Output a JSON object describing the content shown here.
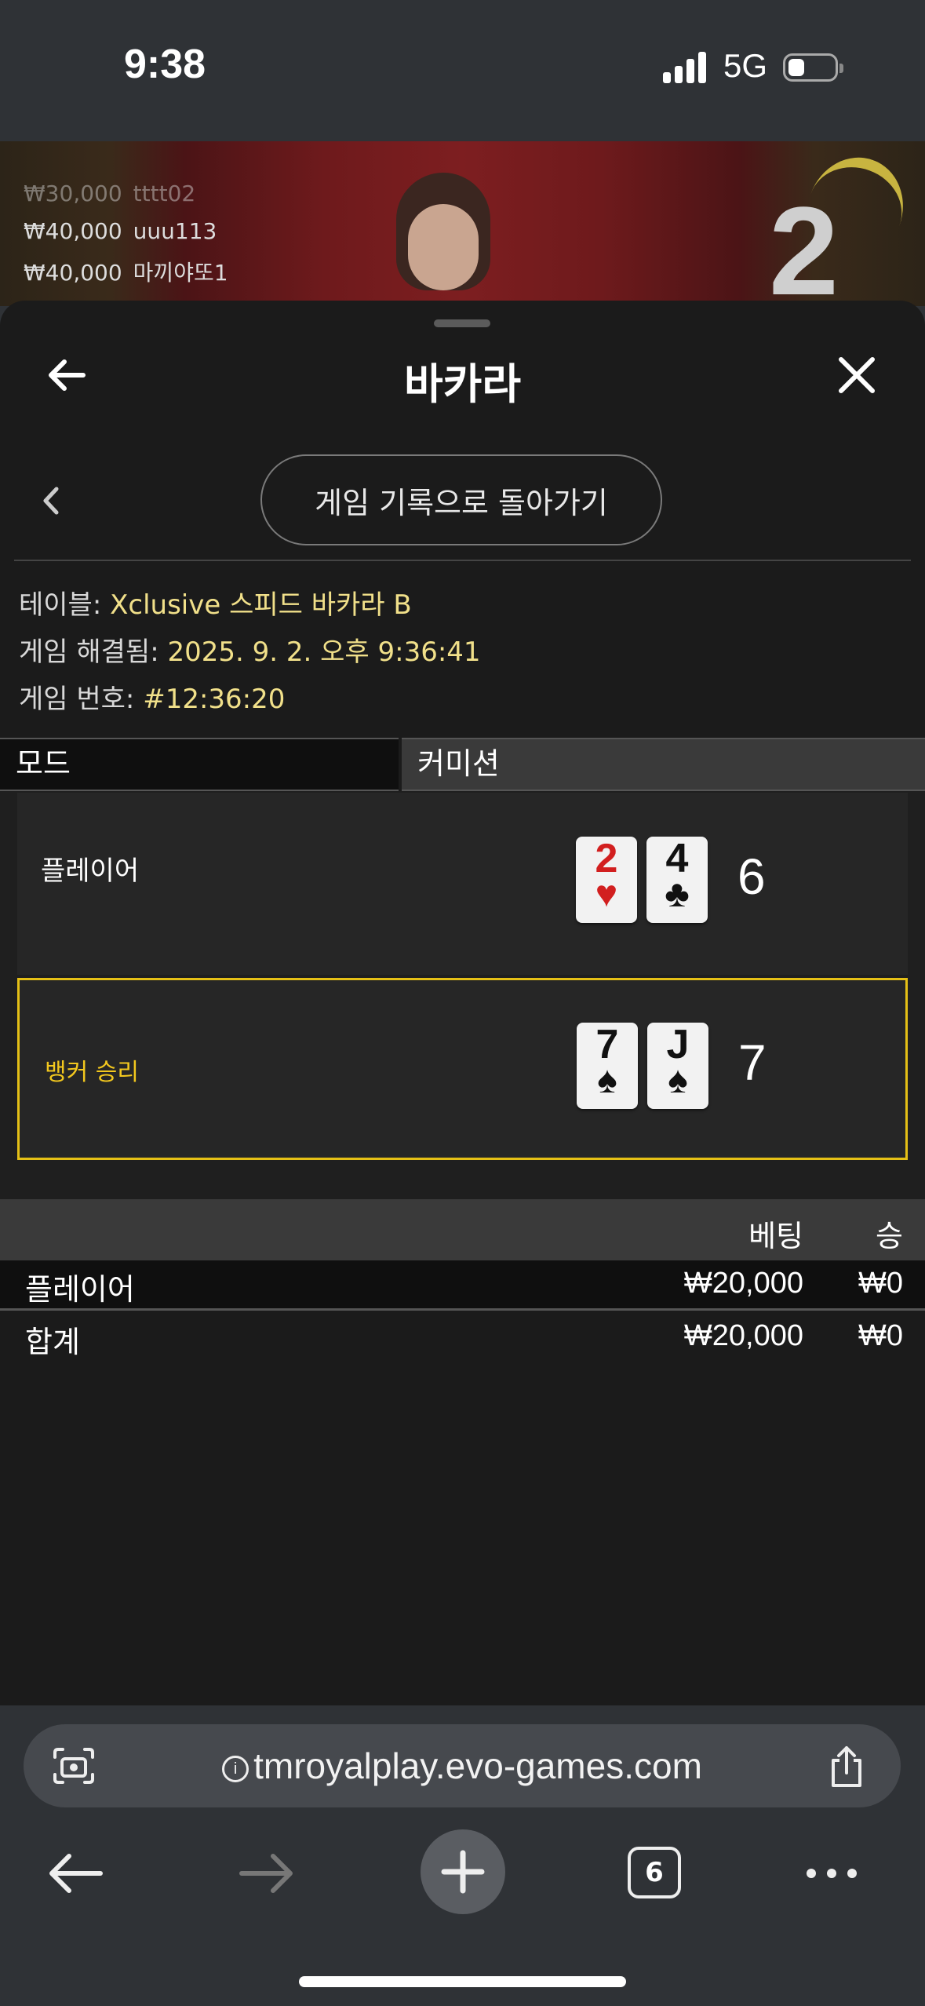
{
  "status_bar": {
    "time": "9:38",
    "network": "5G"
  },
  "video": {
    "ticker": [
      {
        "amount": "₩30,000",
        "user": "tttt02"
      },
      {
        "amount": "₩40,000",
        "user": "uuu113"
      },
      {
        "amount": "₩40,000",
        "user": "마끼야또1"
      }
    ],
    "countdown": "2"
  },
  "header": {
    "title": "바카라"
  },
  "back_to_history": "게임 기록으로 돌아가기",
  "info": {
    "table_label": "테이블:",
    "table_value": "Xclusive 스피드 바카라 B",
    "resolved_label": "게임 해결됨:",
    "resolved_value": "2025. 9. 2. 오후 9:36:41",
    "number_label": "게임 번호:",
    "number_value": "#12:36:20"
  },
  "mode": {
    "label": "모드",
    "value": "커미션"
  },
  "hands": [
    {
      "label": "플레이어",
      "winner": false,
      "score": "6",
      "cards": [
        {
          "rank": "2",
          "suit": "♥",
          "color": "red"
        },
        {
          "rank": "4",
          "suit": "♣",
          "color": "black"
        }
      ]
    },
    {
      "label": "뱅커 승리",
      "winner": true,
      "score": "7",
      "cards": [
        {
          "rank": "7",
          "suit": "♠",
          "color": "black"
        },
        {
          "rank": "J",
          "suit": "♠",
          "color": "black"
        }
      ]
    }
  ],
  "bets": {
    "header_bet": "베팅",
    "header_win": "승",
    "rows": [
      {
        "name": "플레이어",
        "bet": "₩20,000",
        "win": "₩0"
      }
    ],
    "total": {
      "name": "합계",
      "bet": "₩20,000",
      "win": "₩0"
    }
  },
  "browser": {
    "url": "tmroyalplay.evo-games.com",
    "tab_count": "6"
  },
  "colors": {
    "winner_accent": "#e5c016",
    "info_value": "#f1e08a",
    "red_suit": "#d21f1f"
  }
}
